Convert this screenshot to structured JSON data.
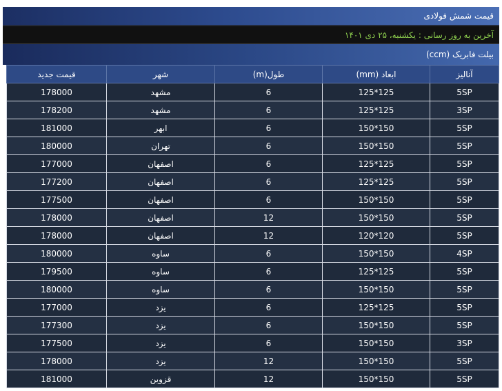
{
  "header": {
    "title": "قیمت شمش فولادی",
    "last_update": "آخرین به روز رسانی : یکشنبه، ۲۵ دی ۱۴۰۱",
    "product_title": "بیلت فابریک (ccm)"
  },
  "table": {
    "columns": [
      "آنالیز",
      "ابعاد (mm)",
      "طول(m)",
      "شهر",
      "قیمت جدید"
    ],
    "rows": [
      [
        "5SP",
        "125*125",
        "6",
        "مشهد",
        "178000"
      ],
      [
        "3SP",
        "125*125",
        "6",
        "مشهد",
        "178200"
      ],
      [
        "5SP",
        "150*150",
        "6",
        "ابهر",
        "181000"
      ],
      [
        "5SP",
        "150*150",
        "6",
        "تهران",
        "180000"
      ],
      [
        "5SP",
        "125*125",
        "6",
        "اصفهان",
        "177000"
      ],
      [
        "5SP",
        "125*125",
        "6",
        "اصفهان",
        "177200"
      ],
      [
        "5SP",
        "150*150",
        "6",
        "اصفهان",
        "177500"
      ],
      [
        "5SP",
        "150*150",
        "12",
        "اصفهان",
        "178000"
      ],
      [
        "5SP",
        "120*120",
        "12",
        "اصفهان",
        "178000"
      ],
      [
        "4SP",
        "150*150",
        "6",
        "ساوه",
        "180000"
      ],
      [
        "5SP",
        "125*125",
        "6",
        "ساوه",
        "179500"
      ],
      [
        "5SP",
        "150*150",
        "6",
        "ساوه",
        "180000"
      ],
      [
        "5SP",
        "125*125",
        "6",
        "یزد",
        "177000"
      ],
      [
        "5SP",
        "150*150",
        "6",
        "یزد",
        "177300"
      ],
      [
        "3SP",
        "150*150",
        "6",
        "یزد",
        "177500"
      ],
      [
        "5SP",
        "150*150",
        "12",
        "یزد",
        "178000"
      ],
      [
        "5SP",
        "150*150",
        "12",
        "قزوین",
        "181000"
      ]
    ]
  }
}
